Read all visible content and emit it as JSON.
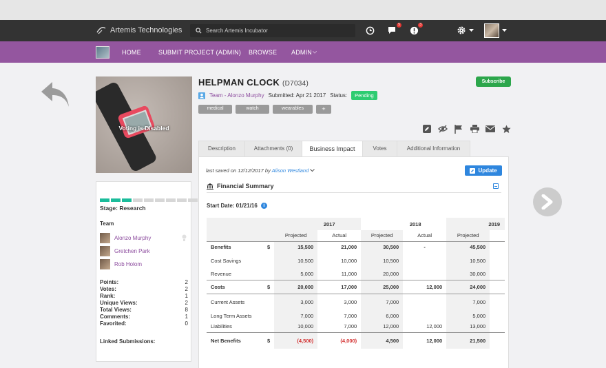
{
  "app": {
    "name": "Artemis Technologies",
    "search_placeholder": "Search Artemis Incubator",
    "chat_badge": "5",
    "alert_badge": "3"
  },
  "nav": [
    "HOME",
    "SUBMIT PROJECT (ADMIN)",
    "BROWSE",
    "ADMIN"
  ],
  "hero": {
    "voting": "Voting is Disabled"
  },
  "project": {
    "title": "HELPMAN CLOCK",
    "id": "(D7034)",
    "team": "Team - Alonzo Murphy",
    "submitted": "Submitted: Apr 21 2017",
    "status_label": "Status:",
    "status": "Pending",
    "subscribe": "Subscribe",
    "tags": [
      "medical",
      "watch",
      "wearables",
      "+"
    ]
  },
  "tabs": [
    "Description",
    "Attachments (0)",
    "Business Impact",
    "Votes",
    "Additional Information"
  ],
  "sidebar": {
    "stage": "Stage: Research",
    "progress_done": 3,
    "progress_total": 9,
    "team_label": "Team",
    "members": [
      "Alonzo Murphy",
      "Gretchen Park",
      "Rob Holom"
    ],
    "stats": [
      [
        "Points:",
        "2"
      ],
      [
        "Votes:",
        "2"
      ],
      [
        "Rank:",
        "1"
      ],
      [
        "Unique Views:",
        "2"
      ],
      [
        "Total Views:",
        "8"
      ],
      [
        "Comments:",
        "1"
      ],
      [
        "Favorited:",
        "0"
      ]
    ],
    "linked": "Linked Submissions:"
  },
  "panel": {
    "saved_prefix": "last saved on 12/12/2017 by ",
    "saved_by": "Alison Westland",
    "update": "Update",
    "section": "Financial Summary",
    "start_date": "Start Date: 01/21/16"
  },
  "table": {
    "years": [
      "2017",
      "2018",
      "2019"
    ],
    "subheads": [
      "Projected",
      "Actual",
      "Projected",
      "Actual",
      "Projected"
    ],
    "rows": [
      {
        "label": "Benefits",
        "cur": "$",
        "vals": [
          "15,500",
          "21,000",
          "30,500",
          "-",
          "45,500"
        ],
        "bold": true
      },
      {
        "label": "Cost Savings",
        "cur": "",
        "vals": [
          "10,500",
          "10,000",
          "10,500",
          "",
          "10,500"
        ]
      },
      {
        "label": "Revenue",
        "cur": "",
        "vals": [
          "5,000",
          "11,000",
          "20,000",
          "",
          "30,000"
        ]
      },
      {
        "label": "Costs",
        "cur": "$",
        "vals": [
          "20,000",
          "17,000",
          "25,000",
          "12,000",
          "24,000"
        ],
        "bold": true
      },
      {
        "label": "Current Assets",
        "cur": "",
        "vals": [
          "3,000",
          "3,000",
          "7,000",
          "",
          "7,000"
        ],
        "topb": true
      },
      {
        "label": "Long Term Assets",
        "cur": "",
        "vals": [
          "7,000",
          "7,000",
          "6,000",
          "",
          "5,000"
        ]
      },
      {
        "label": "Liabilities",
        "cur": "",
        "vals": [
          "10,000",
          "7,000",
          "12,000",
          "12,000",
          "13,000"
        ]
      },
      {
        "label": "Net Benefits",
        "cur": "$",
        "vals": [
          "(4,500)",
          "(4,000)",
          "4,500",
          "12,000",
          "21,500"
        ],
        "bold": true,
        "red": [
          0,
          1
        ]
      }
    ]
  }
}
